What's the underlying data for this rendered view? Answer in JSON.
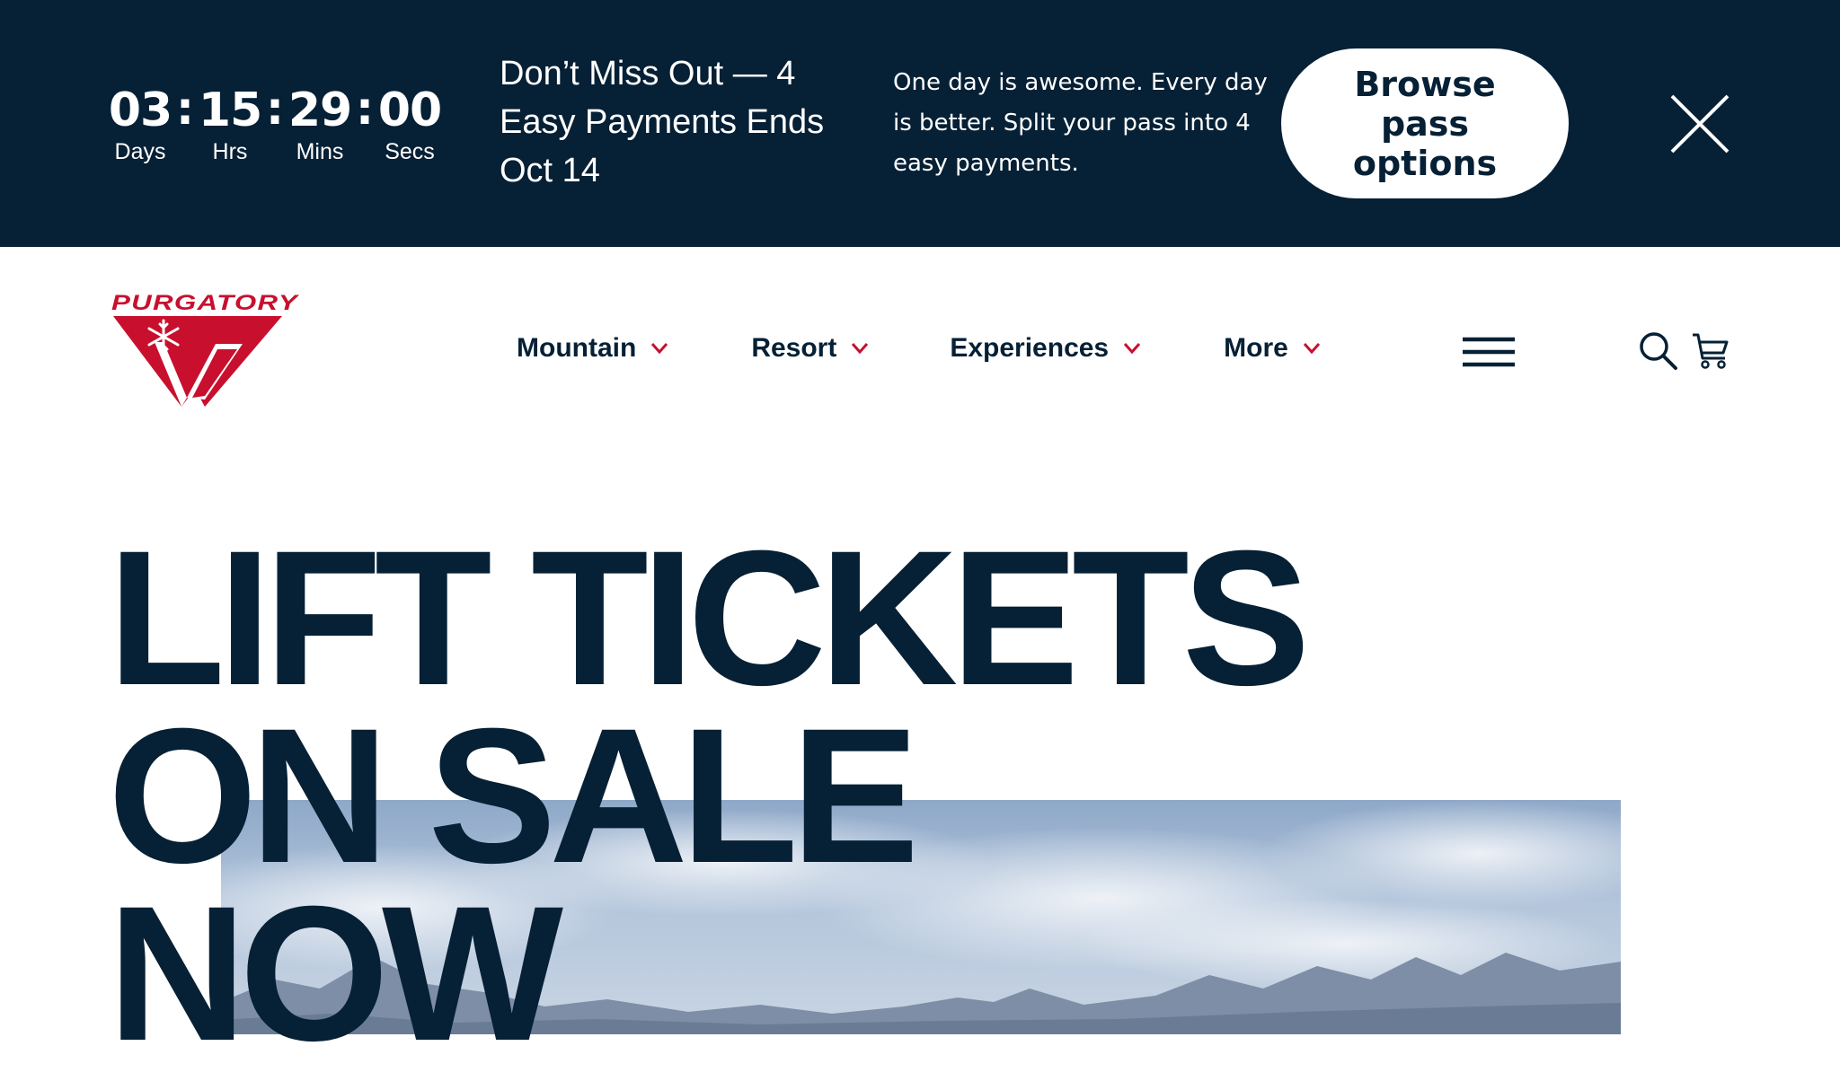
{
  "promo": {
    "countdown": {
      "days": "03",
      "hours": "15",
      "mins": "29",
      "secs": "00",
      "separator": ":",
      "labels": {
        "days": "Days",
        "hours": "Hrs",
        "mins": "Mins",
        "secs": "Secs"
      }
    },
    "headline": "Don’t Miss Out — 4 Easy Payments Ends Oct 14",
    "body": "One day is awesome. Every day is better. Split your pass into 4 easy payments.",
    "cta_label": "Browse pass options",
    "close_icon": "close-icon",
    "background_color": "#062035"
  },
  "header": {
    "logo_text": "PURGATORY",
    "logo_color": "#c8102e",
    "nav": [
      {
        "label": "Mountain"
      },
      {
        "label": "Resort"
      },
      {
        "label": "Experiences"
      },
      {
        "label": "More"
      }
    ],
    "icons": {
      "menu": "hamburger-menu-icon",
      "search": "search-icon",
      "cart": "cart-icon",
      "chevron": "chevron-down-icon"
    },
    "chevron_color": "#c8102e"
  },
  "hero": {
    "title_lines": [
      "LIFT TICKETS",
      "ON SALE",
      "NOW"
    ],
    "image": "mountain-landscape-photo"
  },
  "colors": {
    "navy": "#062035",
    "red": "#c8102e",
    "white": "#ffffff"
  }
}
